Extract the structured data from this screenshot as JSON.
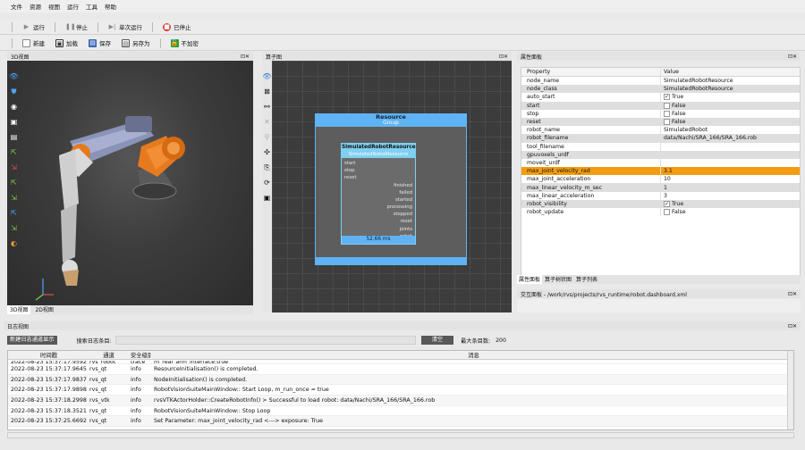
{
  "menu": [
    "文件",
    "资源",
    "视图",
    "运行",
    "工具",
    "帮助"
  ],
  "toolbar1": {
    "run": "运行",
    "stop": "停止",
    "single_run": "单次运行",
    "status": "已停止"
  },
  "toolbar2": {
    "new": "新建",
    "load": "加载",
    "save": "保存",
    "save_as": "另存为",
    "no_load": "不加密"
  },
  "view3d": {
    "title": "3D视图",
    "tabs": [
      "3D视图",
      "2D视图"
    ]
  },
  "opview": {
    "title": "算子图"
  },
  "node": {
    "group_title": "Resource",
    "group_sub": "Group",
    "title": "SimulatedRobotResource",
    "subtitle": "SimulatedRobotResource",
    "inputs": [
      "start",
      "stop",
      "reset"
    ],
    "outputs": [
      "finished",
      "failed",
      "started",
      "processing",
      "stopped",
      "reset",
      "joints",
      "robot"
    ],
    "time": "52.66 ms"
  },
  "props": {
    "title": "属性面板",
    "col_property": "Property",
    "col_value": "Value",
    "rows": [
      {
        "k": "node_name",
        "v": "SimulatedRobotResource",
        "cb": ""
      },
      {
        "k": "node_class",
        "v": "SimulatedRobotResource",
        "cb": ""
      },
      {
        "k": "auto_start",
        "v": "True",
        "cb": "✓"
      },
      {
        "k": "start",
        "v": "False",
        "cb": " "
      },
      {
        "k": "stop",
        "v": "False",
        "cb": " "
      },
      {
        "k": "reset",
        "v": "False",
        "cb": " "
      },
      {
        "k": "robot_name",
        "v": "SimulatedRobot",
        "cb": ""
      },
      {
        "k": "robot_filename",
        "v": "data/Nachi/SRA_166/SRA_166.rob",
        "cb": ""
      },
      {
        "k": "tool_filename",
        "v": "",
        "cb": ""
      },
      {
        "k": "gpuvoxels_urdf",
        "v": "",
        "cb": ""
      },
      {
        "k": "moveit_urdf",
        "v": "",
        "cb": ""
      },
      {
        "k": "max_joint_velocity_rad",
        "v": "3.1",
        "cb": ""
      },
      {
        "k": "max_joint_acceleration",
        "v": "10",
        "cb": ""
      },
      {
        "k": "max_linear_velocity_m_sec",
        "v": "1",
        "cb": ""
      },
      {
        "k": "max_linear_acceleration",
        "v": "3",
        "cb": ""
      },
      {
        "k": "robot_visibility",
        "v": "True",
        "cb": "✓"
      },
      {
        "k": "robot_update",
        "v": "False",
        "cb": " "
      }
    ],
    "tabs": [
      "属性面板",
      "算子树状图",
      "算子列表"
    ]
  },
  "interact": {
    "title": "交互面板 - /work/rvs/projects/rvs_runtime/robot.dashboard.xml"
  },
  "log": {
    "title": "日志视图",
    "new_window": "新建日志通道显示",
    "search_label": "搜索日志条目:",
    "clear": "清空",
    "max_label": "最大条目数:",
    "max_value": "200",
    "headers": [
      "时间戳",
      "通道",
      "安全级别",
      "消息"
    ],
    "partial_row": [
      "2022-08-23 15:37:17.959256",
      "rvs_robot",
      "trace",
      "m_real_arm_interface:true"
    ],
    "rows": [
      [
        "2022-08-23 15:37:17.964525",
        "rvs_qt",
        "info",
        "ResourceInitialisation() is completed."
      ],
      [
        "2022-08-23 15:37:17.983710",
        "rvs_qt",
        "info",
        "NodeInitialisation() is completed."
      ],
      [
        "2022-08-23 15:37:17.989846",
        "rvs_qt",
        "info",
        "RobotVisionSuiteMainWindow:: Start Loop, m_run_once = true"
      ],
      [
        "2022-08-23 15:37:18.299860",
        "rvs_vtk",
        "info",
        "rvsVTKActorHolder::CreateRobotInfo() > Successful to load robot: data/Nachi/SRA_166/SRA_166.rob"
      ],
      [
        "2022-08-23 15:37:18.352187",
        "rvs_qt",
        "info",
        "RobotVisionSuiteMainWindow:: Stop Loop"
      ],
      [
        "2022-08-23 15:37:25.669244",
        "rvs_qt",
        "info",
        "Set Parameter: max_joint_velocity_rad <---> exposure: True"
      ]
    ]
  }
}
